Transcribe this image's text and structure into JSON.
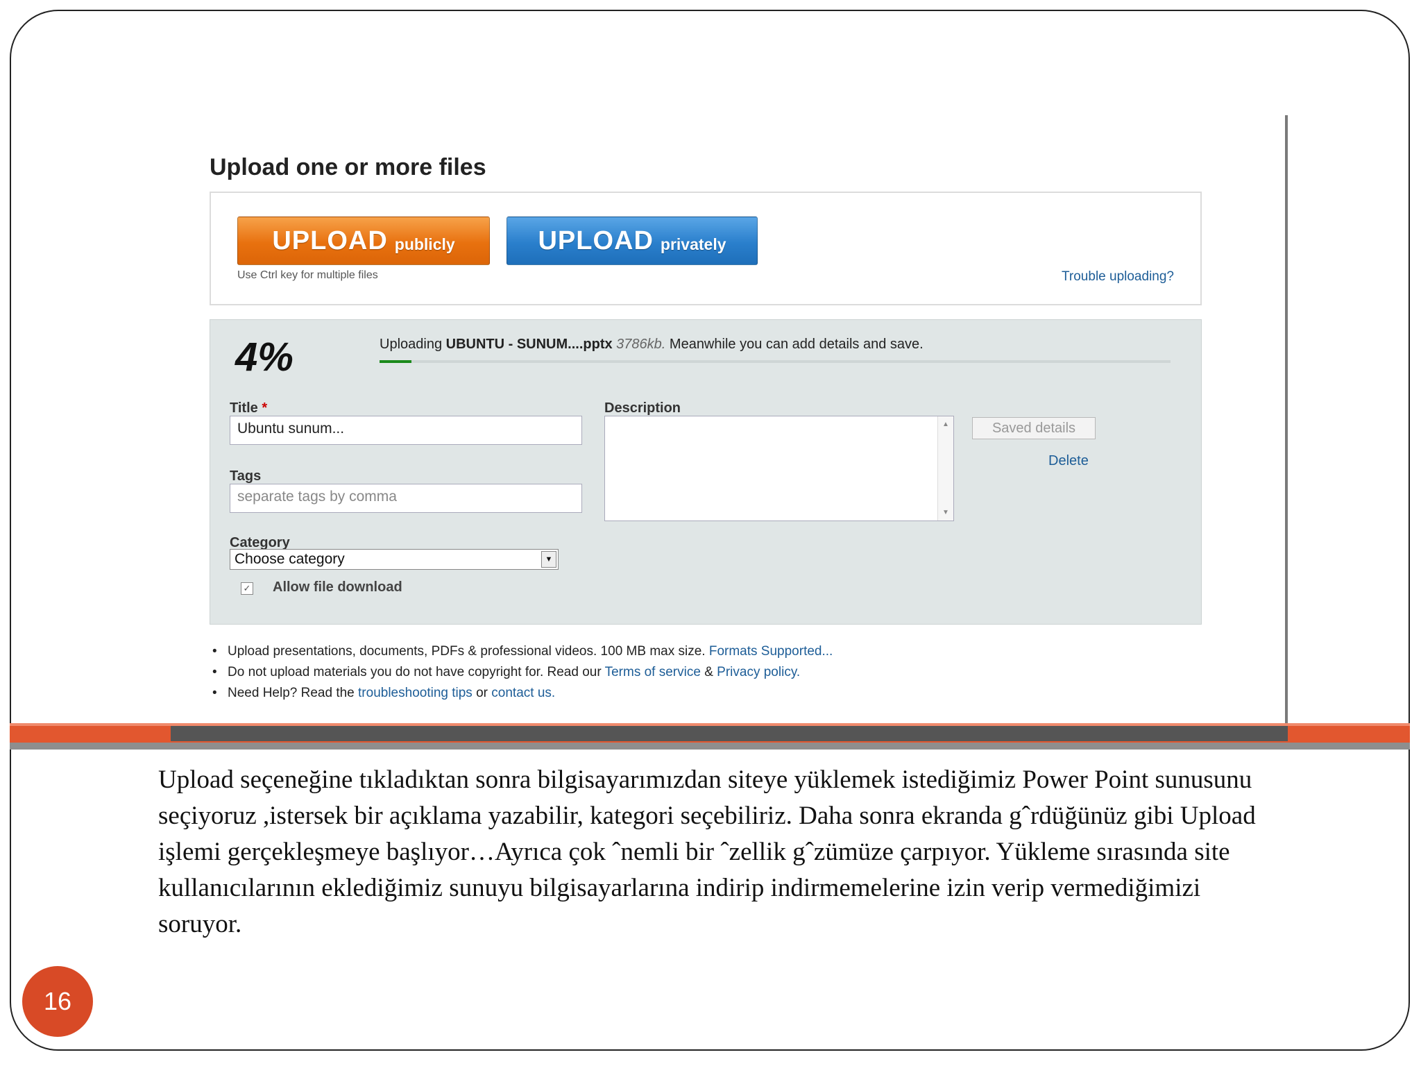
{
  "screenshot": {
    "heading": "Upload one or more files",
    "upload_public": {
      "big": "UPLOAD",
      "small": "publicly"
    },
    "upload_private": {
      "big": "UPLOAD",
      "small": "privately"
    },
    "hint": "Use Ctrl key for multiple files",
    "trouble_link": "Trouble uploading?",
    "progress": {
      "percent_label": "4%",
      "fraction": 0.04,
      "prefix": "Uploading ",
      "file_name": "UBUNTU - SUNUM....pptx",
      "file_size": "3786kb.",
      "suffix": "Meanwhile you can add details and save."
    },
    "form": {
      "title_label": "Title",
      "title_required": "*",
      "title_value": "Ubuntu   sunum...",
      "tags_label": "Tags",
      "tags_placeholder": "separate tags by comma",
      "category_label": "Category",
      "category_value": "Choose category",
      "allow_download_label": "Allow file download",
      "allow_download_checked": true,
      "description_label": "Description",
      "saved_details": "Saved details",
      "delete_link": "Delete"
    },
    "notes": {
      "n1_text": "Upload presentations, documents, PDFs & professional videos. 100 MB max size.",
      "n1_link": "Formats Supported...",
      "n2_text": "Do not upload materials you do not have copyright for. Read our",
      "n2_link1": "Terms of service",
      "n2_amp": "&",
      "n2_link2": "Privacy policy.",
      "n3_text": "Need Help? Read the",
      "n3_link1": "troubleshooting tips",
      "n3_or": "or",
      "n3_link2": "contact us."
    }
  },
  "caption": "Upload seçeneğine tıkladıktan sonra bilgisayarımızdan siteye yüklemek istediğimiz Power Point sunusunu seçiyoruz ,istersek bir açıklama yazabilir, kategori seçebiliriz. Daha sonra ekranda gˆrdüğünüz gibi Upload işlemi gerçekleşmeye başlıyor…Ayrıca çok ˆnemli bir ˆzellik gˆzümüze çarpıyor. Yükleme sırasında site kullanıcılarının eklediğimiz sunuyu bilgisayarlarına indirip indirmemelerine izin verip vermediğimizi soruyor.",
  "page_number": "16",
  "colors": {
    "accent": "#e2572f",
    "link": "#1d5d97",
    "progress": "#1b8a1b"
  }
}
